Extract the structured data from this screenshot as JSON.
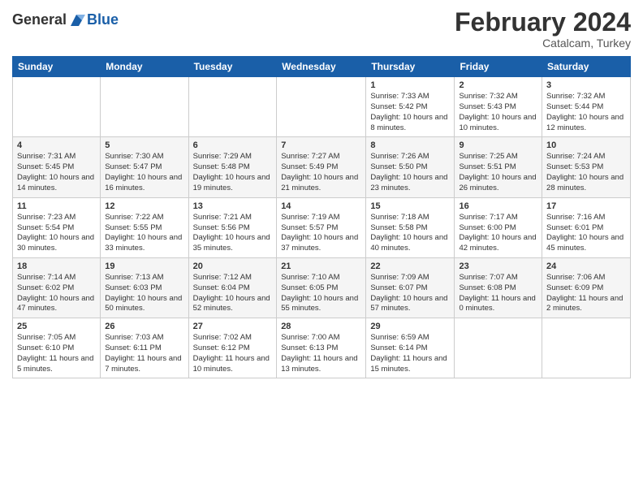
{
  "header": {
    "logo_line1": "General",
    "logo_line2": "Blue",
    "month": "February 2024",
    "location": "Catalcam, Turkey"
  },
  "weekdays": [
    "Sunday",
    "Monday",
    "Tuesday",
    "Wednesday",
    "Thursday",
    "Friday",
    "Saturday"
  ],
  "weeks": [
    [
      {
        "day": "",
        "sunrise": "",
        "sunset": "",
        "daylight": ""
      },
      {
        "day": "",
        "sunrise": "",
        "sunset": "",
        "daylight": ""
      },
      {
        "day": "",
        "sunrise": "",
        "sunset": "",
        "daylight": ""
      },
      {
        "day": "",
        "sunrise": "",
        "sunset": "",
        "daylight": ""
      },
      {
        "day": "1",
        "sunrise": "Sunrise: 7:33 AM",
        "sunset": "Sunset: 5:42 PM",
        "daylight": "Daylight: 10 hours and 8 minutes."
      },
      {
        "day": "2",
        "sunrise": "Sunrise: 7:32 AM",
        "sunset": "Sunset: 5:43 PM",
        "daylight": "Daylight: 10 hours and 10 minutes."
      },
      {
        "day": "3",
        "sunrise": "Sunrise: 7:32 AM",
        "sunset": "Sunset: 5:44 PM",
        "daylight": "Daylight: 10 hours and 12 minutes."
      }
    ],
    [
      {
        "day": "4",
        "sunrise": "Sunrise: 7:31 AM",
        "sunset": "Sunset: 5:45 PM",
        "daylight": "Daylight: 10 hours and 14 minutes."
      },
      {
        "day": "5",
        "sunrise": "Sunrise: 7:30 AM",
        "sunset": "Sunset: 5:47 PM",
        "daylight": "Daylight: 10 hours and 16 minutes."
      },
      {
        "day": "6",
        "sunrise": "Sunrise: 7:29 AM",
        "sunset": "Sunset: 5:48 PM",
        "daylight": "Daylight: 10 hours and 19 minutes."
      },
      {
        "day": "7",
        "sunrise": "Sunrise: 7:27 AM",
        "sunset": "Sunset: 5:49 PM",
        "daylight": "Daylight: 10 hours and 21 minutes."
      },
      {
        "day": "8",
        "sunrise": "Sunrise: 7:26 AM",
        "sunset": "Sunset: 5:50 PM",
        "daylight": "Daylight: 10 hours and 23 minutes."
      },
      {
        "day": "9",
        "sunrise": "Sunrise: 7:25 AM",
        "sunset": "Sunset: 5:51 PM",
        "daylight": "Daylight: 10 hours and 26 minutes."
      },
      {
        "day": "10",
        "sunrise": "Sunrise: 7:24 AM",
        "sunset": "Sunset: 5:53 PM",
        "daylight": "Daylight: 10 hours and 28 minutes."
      }
    ],
    [
      {
        "day": "11",
        "sunrise": "Sunrise: 7:23 AM",
        "sunset": "Sunset: 5:54 PM",
        "daylight": "Daylight: 10 hours and 30 minutes."
      },
      {
        "day": "12",
        "sunrise": "Sunrise: 7:22 AM",
        "sunset": "Sunset: 5:55 PM",
        "daylight": "Daylight: 10 hours and 33 minutes."
      },
      {
        "day": "13",
        "sunrise": "Sunrise: 7:21 AM",
        "sunset": "Sunset: 5:56 PM",
        "daylight": "Daylight: 10 hours and 35 minutes."
      },
      {
        "day": "14",
        "sunrise": "Sunrise: 7:19 AM",
        "sunset": "Sunset: 5:57 PM",
        "daylight": "Daylight: 10 hours and 37 minutes."
      },
      {
        "day": "15",
        "sunrise": "Sunrise: 7:18 AM",
        "sunset": "Sunset: 5:58 PM",
        "daylight": "Daylight: 10 hours and 40 minutes."
      },
      {
        "day": "16",
        "sunrise": "Sunrise: 7:17 AM",
        "sunset": "Sunset: 6:00 PM",
        "daylight": "Daylight: 10 hours and 42 minutes."
      },
      {
        "day": "17",
        "sunrise": "Sunrise: 7:16 AM",
        "sunset": "Sunset: 6:01 PM",
        "daylight": "Daylight: 10 hours and 45 minutes."
      }
    ],
    [
      {
        "day": "18",
        "sunrise": "Sunrise: 7:14 AM",
        "sunset": "Sunset: 6:02 PM",
        "daylight": "Daylight: 10 hours and 47 minutes."
      },
      {
        "day": "19",
        "sunrise": "Sunrise: 7:13 AM",
        "sunset": "Sunset: 6:03 PM",
        "daylight": "Daylight: 10 hours and 50 minutes."
      },
      {
        "day": "20",
        "sunrise": "Sunrise: 7:12 AM",
        "sunset": "Sunset: 6:04 PM",
        "daylight": "Daylight: 10 hours and 52 minutes."
      },
      {
        "day": "21",
        "sunrise": "Sunrise: 7:10 AM",
        "sunset": "Sunset: 6:05 PM",
        "daylight": "Daylight: 10 hours and 55 minutes."
      },
      {
        "day": "22",
        "sunrise": "Sunrise: 7:09 AM",
        "sunset": "Sunset: 6:07 PM",
        "daylight": "Daylight: 10 hours and 57 minutes."
      },
      {
        "day": "23",
        "sunrise": "Sunrise: 7:07 AM",
        "sunset": "Sunset: 6:08 PM",
        "daylight": "Daylight: 11 hours and 0 minutes."
      },
      {
        "day": "24",
        "sunrise": "Sunrise: 7:06 AM",
        "sunset": "Sunset: 6:09 PM",
        "daylight": "Daylight: 11 hours and 2 minutes."
      }
    ],
    [
      {
        "day": "25",
        "sunrise": "Sunrise: 7:05 AM",
        "sunset": "Sunset: 6:10 PM",
        "daylight": "Daylight: 11 hours and 5 minutes."
      },
      {
        "day": "26",
        "sunrise": "Sunrise: 7:03 AM",
        "sunset": "Sunset: 6:11 PM",
        "daylight": "Daylight: 11 hours and 7 minutes."
      },
      {
        "day": "27",
        "sunrise": "Sunrise: 7:02 AM",
        "sunset": "Sunset: 6:12 PM",
        "daylight": "Daylight: 11 hours and 10 minutes."
      },
      {
        "day": "28",
        "sunrise": "Sunrise: 7:00 AM",
        "sunset": "Sunset: 6:13 PM",
        "daylight": "Daylight: 11 hours and 13 minutes."
      },
      {
        "day": "29",
        "sunrise": "Sunrise: 6:59 AM",
        "sunset": "Sunset: 6:14 PM",
        "daylight": "Daylight: 11 hours and 15 minutes."
      },
      {
        "day": "",
        "sunrise": "",
        "sunset": "",
        "daylight": ""
      },
      {
        "day": "",
        "sunrise": "",
        "sunset": "",
        "daylight": ""
      }
    ]
  ]
}
